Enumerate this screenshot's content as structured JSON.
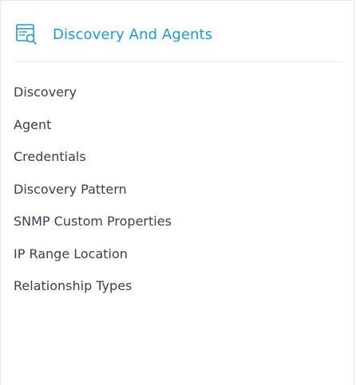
{
  "header": {
    "icon": "discovery-search-icon",
    "title": "Discovery And Agents",
    "accent_color": "#1a9ad6"
  },
  "menu": {
    "items": [
      {
        "label": "Discovery"
      },
      {
        "label": "Agent"
      },
      {
        "label": "Credentials"
      },
      {
        "label": "Discovery Pattern"
      },
      {
        "label": "SNMP Custom Properties"
      },
      {
        "label": "IP Range Location"
      },
      {
        "label": "Relationship Types"
      }
    ]
  }
}
